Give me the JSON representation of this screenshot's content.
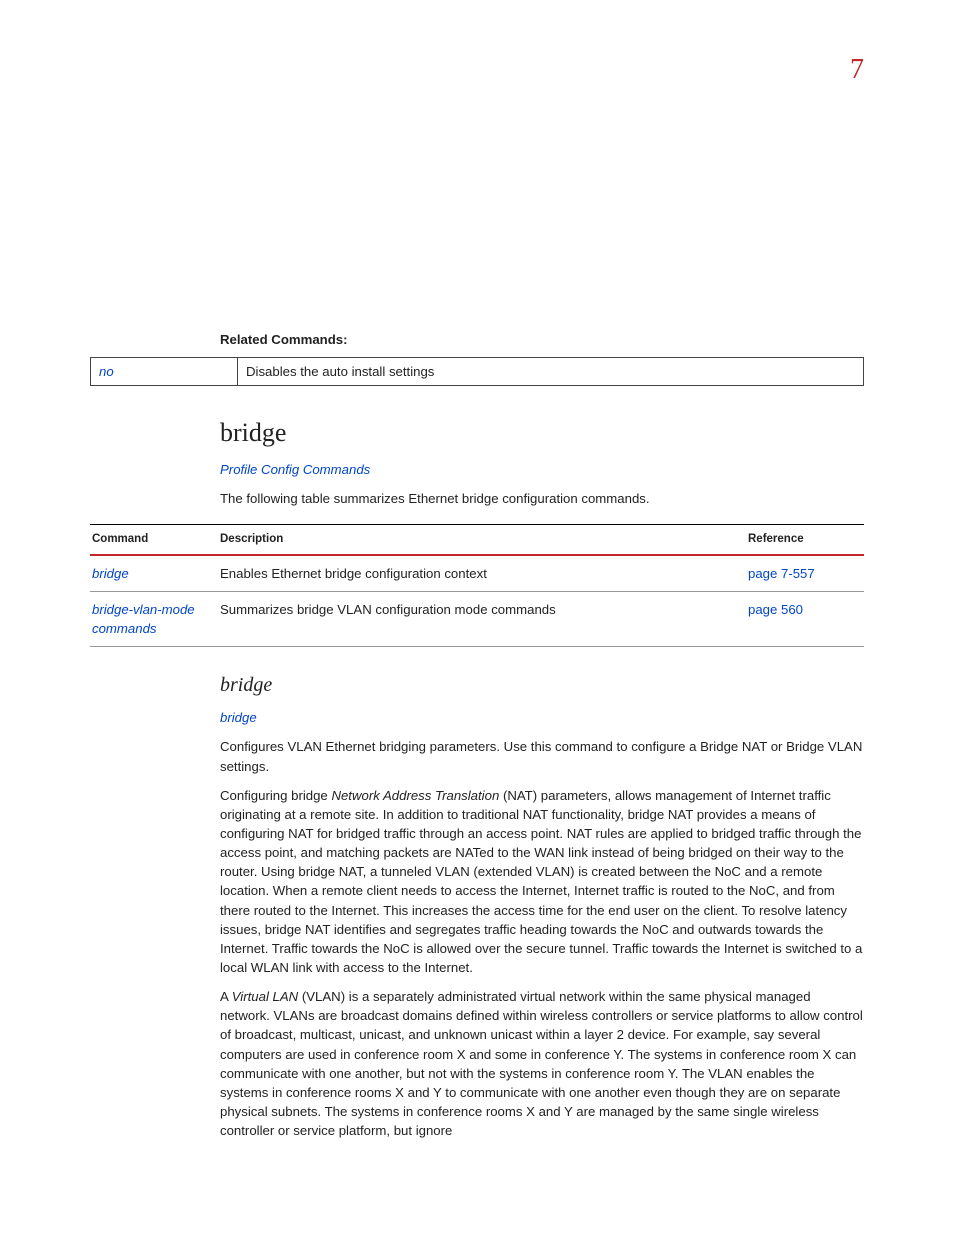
{
  "chapter_number": "7",
  "related": {
    "label": "Related Commands:",
    "row": {
      "cmd": "no",
      "desc": "Disables the auto install settings"
    }
  },
  "section": {
    "title": "bridge",
    "parent_link": "Profile Config Commands",
    "intro": "The following table summarizes Ethernet bridge configuration commands."
  },
  "summary": {
    "headers": {
      "cmd": "Command",
      "desc": "Description",
      "ref": "Reference"
    },
    "rows": [
      {
        "cmd": "bridge",
        "desc": "Enables Ethernet bridge configuration context",
        "ref": "page 7-557"
      },
      {
        "cmd": "bridge-vlan-mode commands",
        "desc": "Summarizes bridge VLAN configuration mode commands",
        "ref": "page 560"
      }
    ]
  },
  "sub": {
    "title": "bridge",
    "link": "bridge",
    "p1": "Configures VLAN Ethernet bridging parameters. Use this command to configure a Bridge NAT or Bridge VLAN settings.",
    "p2_a": "Configuring bridge ",
    "p2_em": "Network Address Translation",
    "p2_b": " (NAT) parameters, allows management of Internet traffic originating at a remote site. In addition to traditional NAT functionality, bridge NAT provides a means of configuring NAT for bridged traffic through an access point. NAT rules are applied to bridged traffic through the access point, and matching packets are NATed to the WAN link instead of being bridged on their way to the router. Using bridge NAT, a tunneled VLAN (extended VLAN) is created between the NoC and a remote location. When a remote client needs to access the Internet, Internet traffic is routed to the NoC, and from there routed to the Internet. This increases the access time for the end user on the client. To resolve latency issues, bridge NAT identifies and segregates traffic heading towards the NoC and outwards towards the Internet. Traffic towards the NoC is allowed over the secure tunnel. Traffic towards the Internet is switched to a local WLAN link with access to the Internet.",
    "p3_a": "A ",
    "p3_em": "Virtual LAN",
    "p3_b": " (VLAN) is a separately administrated virtual network within the same physical managed network. VLANs are broadcast domains defined within wireless controllers or service platforms to allow control of broadcast, multicast, unicast, and unknown unicast within a layer 2 device. For example, say several computers are used in conference room X and some in conference Y. The systems in conference room X can communicate with one another, but not with the systems in conference room Y. The VLAN enables the systems in conference rooms X and Y to communicate with one another even though they are on separate physical subnets. The systems in conference rooms X and Y are managed by the same single wireless controller or service platform, but ignore"
  }
}
